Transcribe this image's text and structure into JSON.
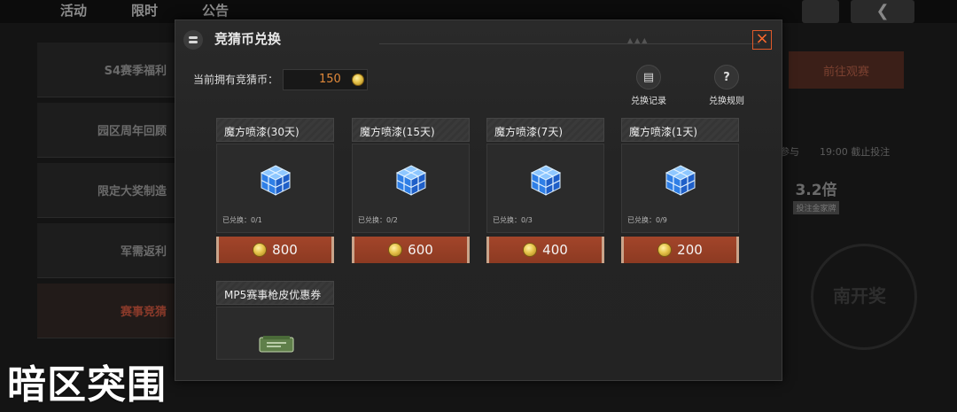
{
  "background": {
    "tabs": [
      "活动",
      "限时",
      "公告"
    ],
    "left_menu": [
      "S4赛季福利",
      "园区周年回顾",
      "限定大奖制造",
      "军需返利",
      "赛事竞猜"
    ],
    "watch_button": "前往观赛",
    "info_texts": [
      "参与",
      "19:00 截止投注"
    ],
    "multiplier": "3.2倍",
    "multiplier_tag": "投注金家牌",
    "circle_text": "南开奖"
  },
  "modal": {
    "title": "竞猜币兑换",
    "close_icon": "×",
    "balance_label": "当前拥有竞猜币：",
    "balance_value": "150",
    "actions": [
      {
        "label": "兑换记录",
        "icon": "document-icon",
        "glyph": "▤"
      },
      {
        "label": "兑换规则",
        "icon": "question-icon",
        "glyph": "?"
      }
    ],
    "items": [
      {
        "name": "魔方喷漆(30天)",
        "count": "已兑换：0/1",
        "price": "800"
      },
      {
        "name": "魔方喷漆(15天)",
        "count": "已兑换：0/2",
        "price": "600"
      },
      {
        "name": "魔方喷漆(7天)",
        "count": "已兑换：0/3",
        "price": "400"
      },
      {
        "name": "魔方喷漆(1天)",
        "count": "已兑换：0/9",
        "price": "200"
      },
      {
        "name": "MP5赛事枪皮优惠券"
      }
    ],
    "colors": {
      "accent": "#a3452a",
      "close": "#ff6a2d",
      "balance": "#e0883a"
    }
  },
  "watermark": "暗区突围"
}
